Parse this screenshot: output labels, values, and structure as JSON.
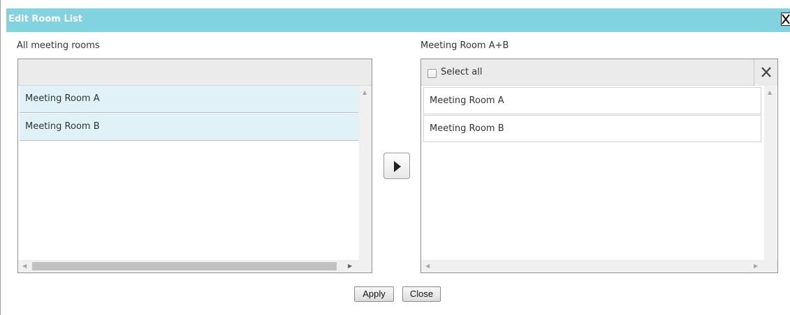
{
  "dialog": {
    "title": "Edit Room List",
    "close_icon": "close-icon"
  },
  "left_panel": {
    "label": "All meeting rooms",
    "items": [
      {
        "label": "Meeting Room A",
        "selected": true
      },
      {
        "label": "Meeting Room B",
        "selected": true
      }
    ]
  },
  "right_panel": {
    "label": "Meeting Room A+B",
    "select_all_label": "Select all",
    "select_all_checked": false,
    "clear_icon": "close-icon",
    "items": [
      {
        "label": "Meeting Room A"
      },
      {
        "label": "Meeting Room B"
      }
    ]
  },
  "move_button_icon": "play-right-icon",
  "footer": {
    "apply_label": "Apply",
    "close_label": "Close"
  },
  "colors": {
    "titlebar": "#81d3df",
    "selected_row": "#e0f2f8"
  }
}
